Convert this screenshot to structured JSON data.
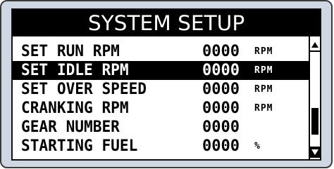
{
  "screen": {
    "title": "SYSTEM SETUP"
  },
  "menu": {
    "items": [
      {
        "label": "SET RUN RPM",
        "value": "0000",
        "unit": "RPM",
        "selected": false
      },
      {
        "label": "SET IDLE RPM",
        "value": "0000",
        "unit": "RPM",
        "selected": true
      },
      {
        "label": "SET OVER SPEED",
        "value": "0000",
        "unit": "RPM",
        "selected": false
      },
      {
        "label": "CRANKING RPM",
        "value": "0000",
        "unit": "RPM",
        "selected": false
      },
      {
        "label": "GEAR NUMBER",
        "value": "0000",
        "unit": "",
        "selected": false
      },
      {
        "label": "STARTING FUEL",
        "value": "0000",
        "unit": "%",
        "selected": false
      }
    ]
  },
  "scrollbar": {
    "position_fraction": 0.82,
    "up_icon": "triangle-up-icon",
    "down_icon": "triangle-down-icon"
  },
  "colors": {
    "display_fg": "#000000",
    "display_bg": "#ffffff",
    "bezel": "#cfd8e2"
  }
}
